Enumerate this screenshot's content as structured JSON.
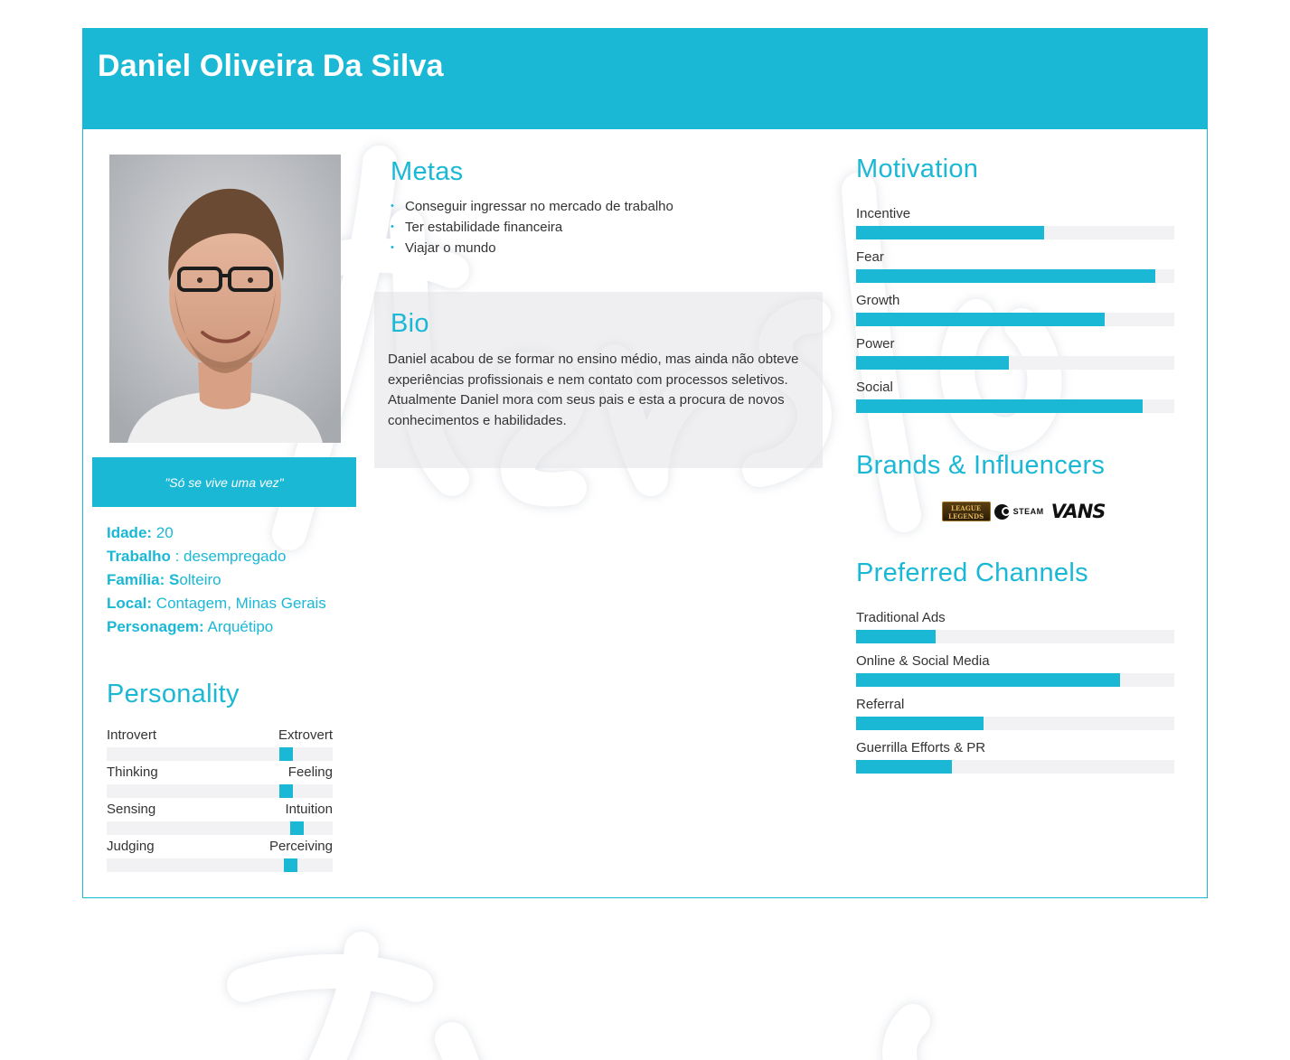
{
  "header": {
    "name": "Daniel Oliveira Da Silva"
  },
  "photo": {
    "alt": "Foto de perfil"
  },
  "quote": "\"Só se vive uma vez\"",
  "facts": [
    {
      "key": "Idade:",
      "value": " 20"
    },
    {
      "key": "Trabalho",
      "value": " : desempregado"
    },
    {
      "key": "Família: S",
      "value": "olteiro"
    },
    {
      "key": "Local:",
      "value": " Contagem, Minas Gerais"
    },
    {
      "key": "Personagem:",
      "value": " Arquétipo"
    }
  ],
  "personality": {
    "title": "Personality",
    "traits": [
      {
        "left": "Introvert",
        "right": "Extrovert",
        "value": 0.79
      },
      {
        "left": "Thinking",
        "right": "Feeling",
        "value": 0.79
      },
      {
        "left": "Sensing",
        "right": "Intuition",
        "value": 0.84
      },
      {
        "left": "Judging",
        "right": "Perceiving",
        "value": 0.81
      }
    ]
  },
  "metas": {
    "title": "Metas",
    "items": [
      "Conseguir ingressar no mercado de trabalho",
      "Ter estabilidade financeira",
      "Viajar o mundo"
    ]
  },
  "bio": {
    "title": "Bio",
    "text": "Daniel acabou de se formar no ensino médio, mas ainda não obteve experiências profissionais e nem contato com processos seletivos. Atualmente Daniel mora com seus pais e esta a procura de novos conhecimentos e habilidades."
  },
  "motivation": {
    "title": "Motivation",
    "items": [
      {
        "label": "Incentive",
        "value": 0.59
      },
      {
        "label": "Fear",
        "value": 0.94
      },
      {
        "label": "Growth",
        "value": 0.78
      },
      {
        "label": "Power",
        "value": 0.48
      },
      {
        "label": "Social",
        "value": 0.9
      }
    ]
  },
  "brands": {
    "title": "Brands & Influencers",
    "logos": [
      {
        "name": "league-of-legends-logo",
        "text": "LEAGUE LEGENDS"
      },
      {
        "name": "steam-logo",
        "text": "STEAM"
      },
      {
        "name": "vans-logo",
        "text": "VANS"
      }
    ]
  },
  "channels": {
    "title": "Preferred Channels",
    "items": [
      {
        "label": "Traditional Ads",
        "value": 0.25
      },
      {
        "label": "Online & Social Media",
        "value": 0.83
      },
      {
        "label": "Referral",
        "value": 0.4
      },
      {
        "label": "Guerrilla Efforts & PR",
        "value": 0.3
      }
    ]
  },
  "colors": {
    "accent": "#1bb8d6",
    "track": "#f2f2f4",
    "text": "#333333"
  }
}
